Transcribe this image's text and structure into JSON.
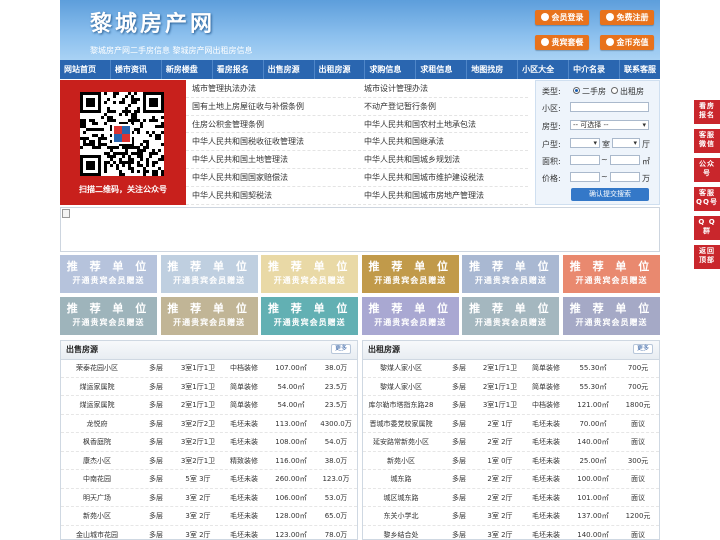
{
  "header": {
    "title": "黎城房产网",
    "subtitle": "黎城房产网二手房信息   黎城房产网出租房信息",
    "buttons": {
      "login": "会员登录",
      "register": "免费注册",
      "package": "贵宾套餐",
      "recharge": "金币充值"
    }
  },
  "nav": [
    "网站首页",
    "楼市资讯",
    "新房楼盘",
    "看房报名",
    "出售房源",
    "出租房源",
    "求购信息",
    "求租信息",
    "地图找房",
    "小区大全",
    "中介名录",
    "联系客服"
  ],
  "qr": {
    "caption": "扫描二维码，关注公众号"
  },
  "news": {
    "left": [
      "城市管理执法办法",
      "国有土地上房屋征收与补偿条例",
      "住房公积金管理条例",
      "中华人民共和国税收征收管理法",
      "中华人民共和国土地管理法",
      "中华人民共和国国家赔偿法",
      "中华人民共和国契税法"
    ],
    "right": [
      "城市设计管理办法",
      "不动产登记暂行条例",
      "中华人民共和国农村土地承包法",
      "中华人民共和国继承法",
      "中华人民共和国城乡规划法",
      "中华人民共和国城市维护建设税法",
      "中华人民共和国城市房地产管理法"
    ]
  },
  "search": {
    "type_label": "类型:",
    "opt_sale": "二手房",
    "opt_rent": "出租房",
    "community_label": "小区:",
    "house_type_label": "房型:",
    "house_type_value": "-- 可选择 --",
    "layout_label": "户型:",
    "room_unit": "室",
    "hall_unit": "厅",
    "area_label": "面积:",
    "area_unit": "㎡",
    "range_sep": "~",
    "price_label": "价格:",
    "price_unit": "万",
    "submit": "确认提交搜索"
  },
  "promos": {
    "title": "推 荐 单 位",
    "subtitle": "开通贵宾会员赠送",
    "colors": [
      "#b6c3dc",
      "#bfcfe0",
      "#e9d9a6",
      "#c19a4a",
      "#a9b8d2",
      "#e9896f",
      "#9eb4bb",
      "#c1b596",
      "#62b0b3",
      "#a9a8d2",
      "#a4b7bf",
      "#a5a9c6"
    ]
  },
  "sale": {
    "title": "出售房源",
    "more": "更多",
    "rows": [
      [
        "荣泰花园小区",
        "多层",
        "3室1厅1卫",
        "中档装修",
        "107.00㎡",
        "38.0万"
      ],
      [
        "煤运家属院",
        "多层",
        "3室1厅1卫",
        "简单装修",
        "54.00㎡",
        "23.5万"
      ],
      [
        "煤运家属院",
        "多层",
        "2室1厅1卫",
        "简单装修",
        "54.00㎡",
        "23.5万"
      ],
      [
        "龙悦府",
        "多层",
        "3室2厅2卫",
        "毛坯未装",
        "113.00㎡",
        "4300.0万"
      ],
      [
        "枫香庭院",
        "多层",
        "3室2厅1卫",
        "毛坯未装",
        "108.00㎡",
        "54.0万"
      ],
      [
        "康杰小区",
        "多层",
        "3室2厅1卫",
        "精致装修",
        "116.00㎡",
        "38.0万"
      ],
      [
        "中南花园",
        "多层",
        "5室 3厅",
        "毛坯未装",
        "260.00㎡",
        "123.0万"
      ],
      [
        "明天广场",
        "多层",
        "3室 2厅",
        "毛坯未装",
        "106.00㎡",
        "53.0万"
      ],
      [
        "新苑小区",
        "多层",
        "3室 2厅",
        "毛坯未装",
        "128.00㎡",
        "65.0万"
      ],
      [
        "金山城市花园",
        "多层",
        "3室 2厅",
        "毛坯未装",
        "123.00㎡",
        "78.0万"
      ]
    ]
  },
  "rent": {
    "title": "出租房源",
    "more": "更多",
    "rows": [
      [
        "黎煤人家小区",
        "多层",
        "2室1厅1卫",
        "简单装修",
        "55.30㎡",
        "700元"
      ],
      [
        "黎煤人家小区",
        "多层",
        "2室1厅1卫",
        "简单装修",
        "55.30㎡",
        "700元"
      ],
      [
        "库尔勒市塔指东路28",
        "多层",
        "3室1厅1卫",
        "中档装修",
        "121.00㎡",
        "1800元"
      ],
      [
        "晋城市委党校家属院",
        "多层",
        "2室 1厅",
        "毛坯未装",
        "70.00㎡",
        "面议"
      ],
      [
        "延安路常新苑小区",
        "多层",
        "2室 2厅",
        "毛坯未装",
        "140.00㎡",
        "面议"
      ],
      [
        "新苑小区",
        "多层",
        "1室 0厅",
        "毛坯未装",
        "25.00㎡",
        "300元"
      ],
      [
        "城东路",
        "多层",
        "2室 2厅",
        "毛坯未装",
        "100.00㎡",
        "面议"
      ],
      [
        "城区城东路",
        "多层",
        "2室 2厅",
        "毛坯未装",
        "101.00㎡",
        "面议"
      ],
      [
        "东关小学北",
        "多层",
        "3室 2厅",
        "毛坯未装",
        "137.00㎡",
        "1200元"
      ],
      [
        "黎乡结合处",
        "多层",
        "3室 2厅",
        "毛坯未装",
        "140.00㎡",
        "面议"
      ]
    ]
  },
  "sidebar": [
    [
      "看房",
      "报名"
    ],
    [
      "客服",
      "微信"
    ],
    [
      "公众",
      "号"
    ],
    [
      "客服",
      "QQ号"
    ],
    [
      "Q Q",
      "群"
    ],
    [
      "返回",
      "顶部"
    ]
  ]
}
